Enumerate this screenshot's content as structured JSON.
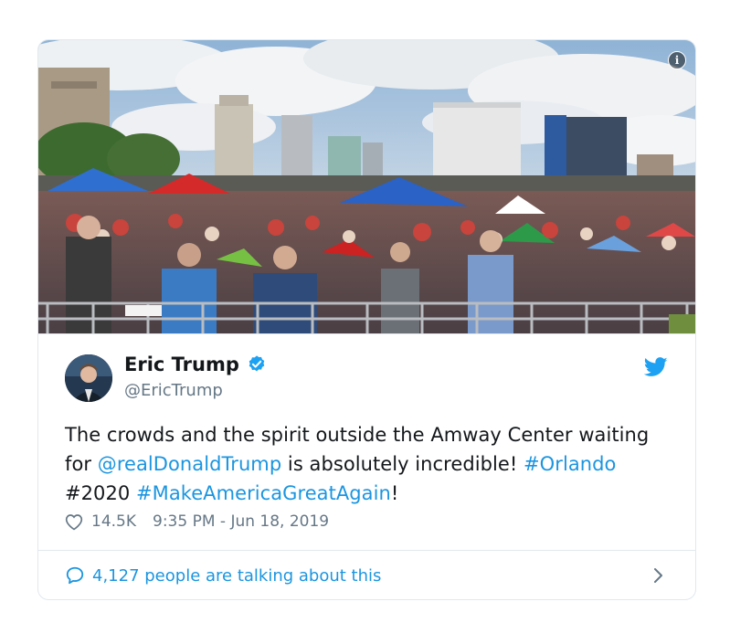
{
  "tweet": {
    "author_name": "Eric Trump",
    "author_handle": "@EricTrump",
    "text_parts": {
      "p1": "The crowds and the spirit outside the Amway Center waiting for ",
      "mention": "@realDonaldTrump",
      "p2": " is absolutely incredible! ",
      "tag1": "#Orlando",
      "p3": " #2020 ",
      "tag2": "#MakeAmericaGreatAgain",
      "p4": "!"
    },
    "likes": "14.5K",
    "timestamp": "9:35 PM - Jun 18, 2019",
    "conversation": "4,127 people are talking about this"
  },
  "icons": {
    "info": "info-icon",
    "verified": "verified-badge-icon",
    "brand": "twitter-bird-icon",
    "like": "heart-icon",
    "reply": "speech-bubble-icon",
    "chevron": "chevron-right-icon"
  },
  "colors": {
    "accent": "#1b95e0",
    "verified": "#1da1f2",
    "muted": "#657786",
    "text": "#14171a",
    "border": "#e1e8ed"
  }
}
